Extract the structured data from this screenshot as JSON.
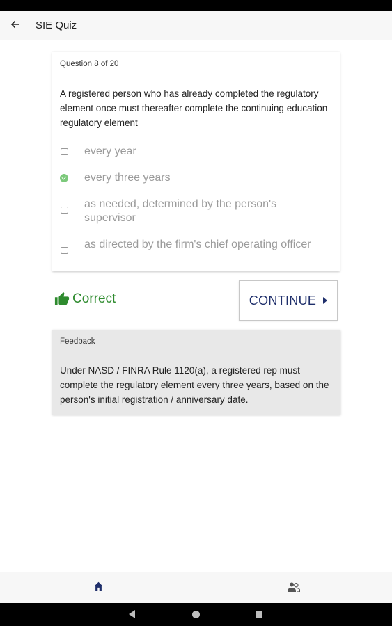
{
  "app_bar": {
    "title": "SIE Quiz",
    "back_icon": "arrow-left-icon"
  },
  "question": {
    "counter": "Question 8 of 20",
    "text": "A registered person who has already completed the regulatory element once must thereafter complete the continuing education regulatory element",
    "options": [
      {
        "label": "every year",
        "state": "unchecked"
      },
      {
        "label": "every three years",
        "state": "correct"
      },
      {
        "label": "as needed, determined by the person's supervisor",
        "state": "unchecked"
      },
      {
        "label": "as directed by the firm's chief operating officer",
        "state": "unchecked"
      }
    ]
  },
  "result": {
    "text": "Correct",
    "icon": "thumbs-up-icon",
    "color": "#2e8b2e"
  },
  "continue_button": {
    "label": "CONTINUE",
    "icon": "caret-right-icon",
    "color": "#1f2f6b"
  },
  "feedback": {
    "title": "Feedback",
    "text": "Under NASD / FINRA Rule 1120(a), a registered rep must complete the regulatory element every three years, based on the person's initial registration / anniversary date."
  },
  "bottom_nav": {
    "items": [
      {
        "icon": "home-icon",
        "active": true,
        "color": "#1f2f6b"
      },
      {
        "icon": "users-icon",
        "active": false,
        "color": "#555555"
      }
    ]
  },
  "system_nav": {
    "icons": [
      "back-triangle-icon",
      "home-circle-icon",
      "recents-square-icon"
    ]
  }
}
